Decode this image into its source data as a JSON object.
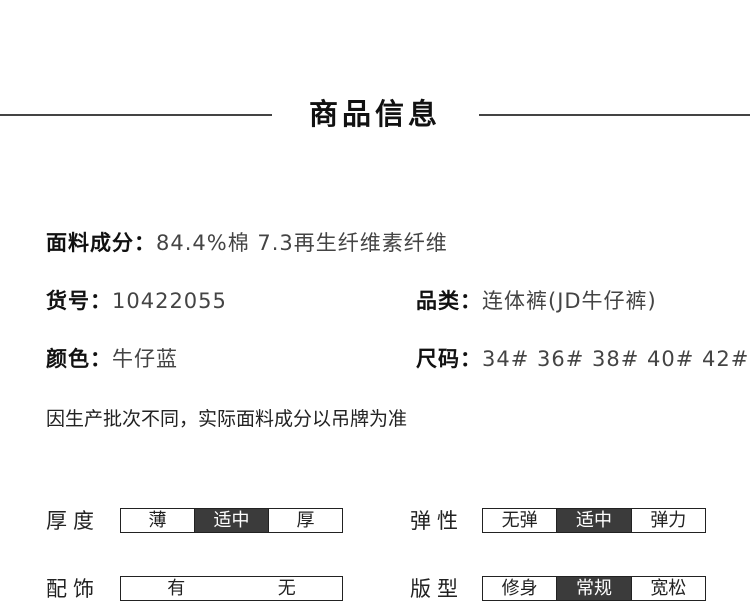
{
  "section": {
    "title": "商品信息"
  },
  "info": {
    "material_key": "面料成分：",
    "material_val": "84.4%棉 7.3再生纤维素纤维",
    "sku_key": "货号：",
    "sku_val": "10422055",
    "category_key": "品类：",
    "category_val": "连体裤(JD牛仔裤)",
    "color_key": "颜色：",
    "color_val": "牛仔蓝",
    "size_key": "尺码：",
    "size_val": "34# 36# 38# 40# 42#"
  },
  "note": "因生产批次不同，实际面料成分以吊牌为准",
  "attributes": {
    "thickness": {
      "label": "厚度",
      "options": [
        "薄",
        "适中",
        "厚"
      ],
      "selected": "适中"
    },
    "elasticity": {
      "label": "弹性",
      "options": [
        "无弹",
        "适中",
        "弹力"
      ],
      "selected": "适中"
    },
    "accessory": {
      "label": "配饰",
      "options": [
        "有",
        "无"
      ],
      "selected": ""
    },
    "fit": {
      "label": "版型",
      "options": [
        "修身",
        "常规",
        "宽松"
      ],
      "selected": "常规"
    }
  },
  "colors": {
    "selected_bg": "#3b3b3b",
    "border": "#222222"
  }
}
